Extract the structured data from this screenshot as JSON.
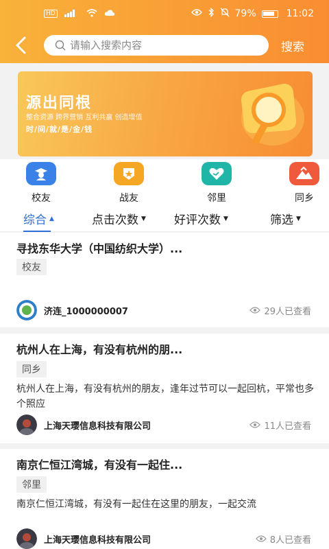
{
  "status_bar": {
    "left_labels": [
      "HD",
      "⁴⁶"
    ],
    "battery": "79%",
    "time": "11:02"
  },
  "search": {
    "placeholder": "请输入搜索内容",
    "button": "搜索"
  },
  "banner": {
    "title": "源出同根",
    "subtitle": "整合资源 跨界营销 互利共赢 创造增值",
    "tagline": "时/间/就/是/金/钱"
  },
  "categories": [
    {
      "label": "校友",
      "icon": "graduate-icon",
      "color": "#3b82e8"
    },
    {
      "label": "战友",
      "icon": "star-badge-icon",
      "color": "#f5a623"
    },
    {
      "label": "邻里",
      "icon": "handshake-heart-icon",
      "color": "#1fb6a8"
    },
    {
      "label": "同乡",
      "icon": "mountain-icon",
      "color": "#f05a3c"
    }
  ],
  "filters": [
    {
      "label": "综合",
      "active": true
    },
    {
      "label": "点击次数",
      "active": false
    },
    {
      "label": "好评次数",
      "active": false
    },
    {
      "label": "筛选",
      "active": false
    }
  ],
  "posts": [
    {
      "title": "寻找东华大学（中国纺织大学）...",
      "tag": "校友",
      "description": "",
      "author": "济连_1000000007",
      "views": "29人已查看"
    },
    {
      "title": "杭州人在上海，有没有杭州的朋...",
      "tag": "同乡",
      "description": "杭州人在上海，有没有杭州的朋友，逢年过节可以一起回杭，平常也多个照应",
      "author": "上海天璎信息科技有限公司",
      "views": "11人已查看"
    },
    {
      "title": "南京仁恒江湾城，有没有一起住...",
      "tag": "邻里",
      "description": "南京仁恒江湾城，有没有一起住在这里的朋友，一起交流",
      "author": "上海天璎信息科技有限公司",
      "views": "8人已查看"
    }
  ]
}
